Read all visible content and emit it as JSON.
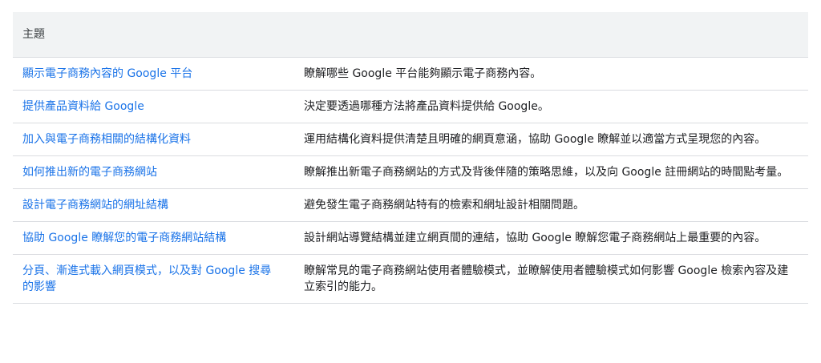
{
  "table": {
    "header": "主題",
    "rows": [
      {
        "topic": "顯示電子商務內容的 Google 平台",
        "description": "瞭解哪些 Google 平台能夠顯示電子商務內容。"
      },
      {
        "topic": "提供產品資料給 Google",
        "description": "決定要透過哪種方法將產品資料提供給 Google。"
      },
      {
        "topic": "加入與電子商務相關的結構化資料",
        "description": "運用結構化資料提供清楚且明確的網頁意涵，協助 Google 瞭解並以適當方式呈現您的內容。"
      },
      {
        "topic": "如何推出新的電子商務網站",
        "description": "瞭解推出新電子商務網站的方式及背後伴隨的策略思維，以及向 Google 註冊網站的時間點考量。"
      },
      {
        "topic": "設計電子商務網站的網址結構",
        "description": "避免發生電子商務網站特有的檢索和網址設計相關問題。"
      },
      {
        "topic": "協助 Google 瞭解您的電子商務網站結構",
        "description": "設計網站導覽結構並建立網頁間的連結，協助 Google 瞭解您電子商務網站上最重要的內容。"
      },
      {
        "topic": "分頁、漸進式載入網頁模式，以及對 Google 搜尋的影響",
        "description": "瞭解常見的電子商務網站使用者體驗模式，並瞭解使用者體驗模式如何影響 Google 檢索內容及建立索引的能力。"
      }
    ]
  }
}
